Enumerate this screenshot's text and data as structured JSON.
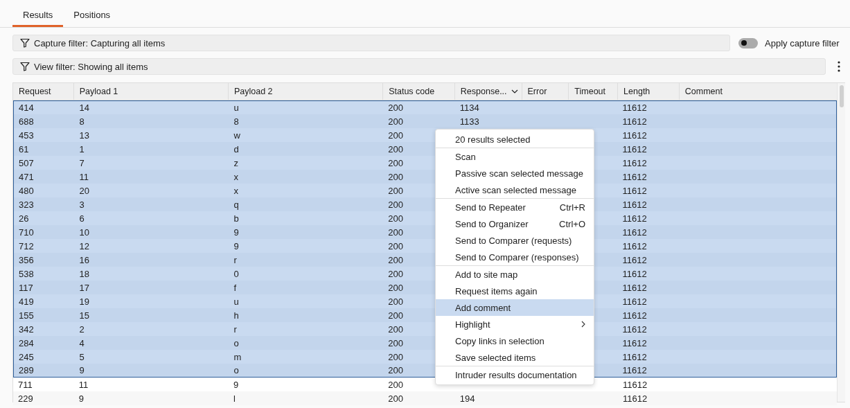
{
  "tabs": [
    {
      "label": "Results",
      "selected": true
    },
    {
      "label": "Positions",
      "selected": false
    }
  ],
  "capture_filter": {
    "label": "Capture filter: Capturing all items"
  },
  "apply_capture_filter": {
    "label": "Apply capture filter",
    "on": false
  },
  "view_filter": {
    "label": "View filter: Showing all items"
  },
  "table": {
    "columns": [
      {
        "label": "Request"
      },
      {
        "label": "Payload 1"
      },
      {
        "label": "Payload 2"
      },
      {
        "label": "Status code"
      },
      {
        "label": "Response...",
        "sorted_descending": true
      },
      {
        "label": "Error"
      },
      {
        "label": "Timeout"
      },
      {
        "label": "Length"
      },
      {
        "label": "Comment"
      }
    ],
    "rows": [
      {
        "cells": [
          "414",
          "14",
          "u",
          "200",
          "1134",
          "",
          "",
          "11612",
          ""
        ],
        "selected": true
      },
      {
        "cells": [
          "688",
          "8",
          "8",
          "200",
          "1133",
          "",
          "",
          "11612",
          ""
        ],
        "selected": true
      },
      {
        "cells": [
          "453",
          "13",
          "w",
          "200",
          "",
          "",
          "",
          "11612",
          ""
        ],
        "selected": true
      },
      {
        "cells": [
          "61",
          "1",
          "d",
          "200",
          "",
          "",
          "",
          "11612",
          ""
        ],
        "selected": true
      },
      {
        "cells": [
          "507",
          "7",
          "z",
          "200",
          "",
          "",
          "",
          "11612",
          ""
        ],
        "selected": true
      },
      {
        "cells": [
          "471",
          "11",
          "x",
          "200",
          "",
          "",
          "",
          "11612",
          ""
        ],
        "selected": true
      },
      {
        "cells": [
          "480",
          "20",
          "x",
          "200",
          "",
          "",
          "",
          "11612",
          ""
        ],
        "selected": true
      },
      {
        "cells": [
          "323",
          "3",
          "q",
          "200",
          "",
          "",
          "",
          "11612",
          ""
        ],
        "selected": true
      },
      {
        "cells": [
          "26",
          "6",
          "b",
          "200",
          "",
          "",
          "",
          "11612",
          ""
        ],
        "selected": true
      },
      {
        "cells": [
          "710",
          "10",
          "9",
          "200",
          "",
          "",
          "",
          "11612",
          ""
        ],
        "selected": true
      },
      {
        "cells": [
          "712",
          "12",
          "9",
          "200",
          "",
          "",
          "",
          "11612",
          ""
        ],
        "selected": true
      },
      {
        "cells": [
          "356",
          "16",
          "r",
          "200",
          "",
          "",
          "",
          "11612",
          ""
        ],
        "selected": true
      },
      {
        "cells": [
          "538",
          "18",
          "0",
          "200",
          "",
          "",
          "",
          "11612",
          ""
        ],
        "selected": true
      },
      {
        "cells": [
          "117",
          "17",
          "f",
          "200",
          "",
          "",
          "",
          "11612",
          ""
        ],
        "selected": true
      },
      {
        "cells": [
          "419",
          "19",
          "u",
          "200",
          "",
          "",
          "",
          "11612",
          ""
        ],
        "selected": true
      },
      {
        "cells": [
          "155",
          "15",
          "h",
          "200",
          "",
          "",
          "",
          "11612",
          ""
        ],
        "selected": true
      },
      {
        "cells": [
          "342",
          "2",
          "r",
          "200",
          "",
          "",
          "",
          "11612",
          ""
        ],
        "selected": true
      },
      {
        "cells": [
          "284",
          "4",
          "o",
          "200",
          "",
          "",
          "",
          "11612",
          ""
        ],
        "selected": true
      },
      {
        "cells": [
          "245",
          "5",
          "m",
          "200",
          "",
          "",
          "",
          "11612",
          ""
        ],
        "selected": true
      },
      {
        "cells": [
          "289",
          "9",
          "o",
          "200",
          "",
          "",
          "",
          "11612",
          ""
        ],
        "selected": true
      },
      {
        "cells": [
          "711",
          "11",
          "9",
          "200",
          "",
          "",
          "",
          "11612",
          ""
        ],
        "selected": false
      },
      {
        "cells": [
          "229",
          "9",
          "l",
          "200",
          "194",
          "",
          "",
          "11612",
          ""
        ],
        "selected": false
      }
    ]
  },
  "context_menu": {
    "title": "20 results selected",
    "sections": [
      [
        {
          "label": "Scan",
          "selected": false
        },
        {
          "label": "Passive scan selected message",
          "selected": false
        },
        {
          "label": "Active scan selected message",
          "selected": false
        }
      ],
      [
        {
          "label": "Send to Repeater",
          "shortcut": "Ctrl+R",
          "selected": false
        },
        {
          "label": "Send to Organizer",
          "shortcut": "Ctrl+O",
          "selected": false
        },
        {
          "label": "Send to Comparer (requests)",
          "selected": false
        },
        {
          "label": "Send to Comparer (responses)",
          "selected": false
        }
      ],
      [
        {
          "label": "Add to site map",
          "selected": false
        },
        {
          "label": "Request items again",
          "selected": false
        },
        {
          "label": "Add comment",
          "selected": true
        },
        {
          "label": "Highlight",
          "submenu": true,
          "selected": false
        },
        {
          "label": "Copy links in selection",
          "selected": false
        },
        {
          "label": "Save selected items",
          "selected": false
        }
      ],
      [
        {
          "label": "Intruder results documentation",
          "selected": false
        }
      ]
    ]
  }
}
